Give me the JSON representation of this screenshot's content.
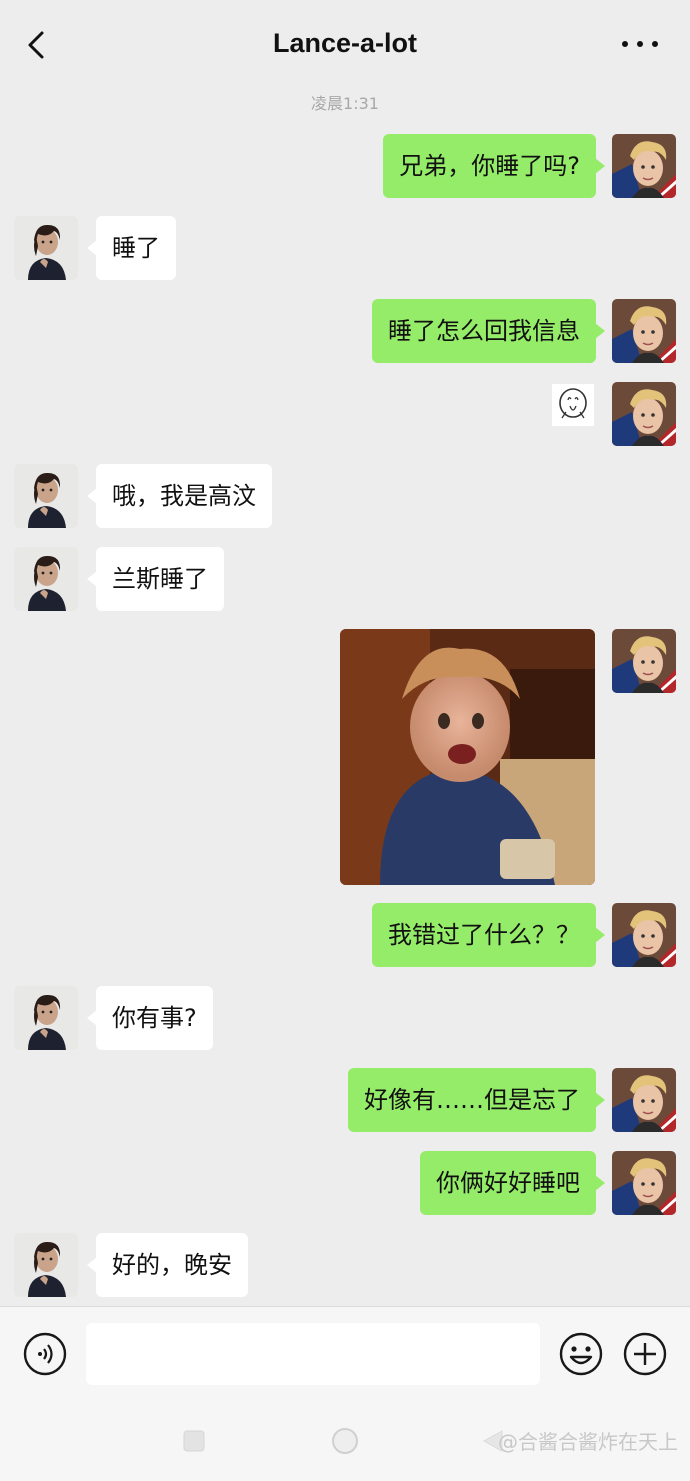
{
  "header": {
    "title": "Lance-a-lot",
    "back_icon": "chevron-left-icon",
    "more_icon": "more-dots-icon"
  },
  "chat": {
    "timestamp": "凌晨1:31",
    "messages": [
      {
        "side": "out",
        "text": "兄弟，你睡了吗?"
      },
      {
        "side": "in",
        "text": "睡了"
      },
      {
        "side": "out",
        "text": "睡了怎么回我信息"
      },
      {
        "side": "out",
        "type": "sticker",
        "icon": "sticker-face-icon"
      },
      {
        "side": "in",
        "text": "哦，我是高汶"
      },
      {
        "side": "in",
        "text": "兰斯睡了"
      },
      {
        "side": "out",
        "type": "image",
        "icon": "meme-photo"
      },
      {
        "side": "out",
        "text": "我错过了什么？？"
      },
      {
        "side": "in",
        "text": "你有事?"
      },
      {
        "side": "out",
        "text": "好像有……但是忘了"
      },
      {
        "side": "out",
        "text": "你俩好好睡吧"
      },
      {
        "side": "in",
        "text": "好的，晚安"
      }
    ]
  },
  "input_bar": {
    "value": "",
    "voice_icon": "voice-icon",
    "emoji_icon": "emoji-icon",
    "plus_icon": "plus-icon"
  },
  "watermark": {
    "credit": "@合酱合酱炸在天上"
  },
  "colors": {
    "background": "#ededed",
    "outgoing_bubble": "#95ec69",
    "incoming_bubble": "#ffffff",
    "timestamp": "#a8a8a8"
  }
}
